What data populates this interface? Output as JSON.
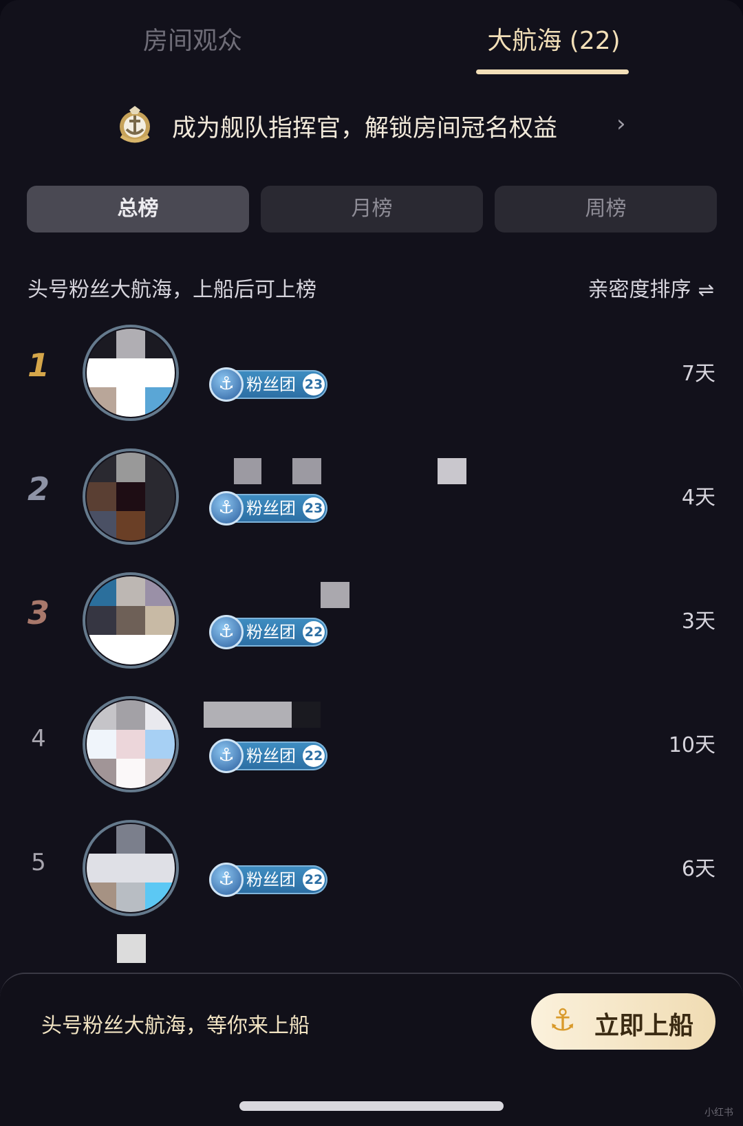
{
  "tabs": {
    "audience": "房间观众",
    "fleet": "大航海 (22)"
  },
  "promo": {
    "text": "成为舰队指挥官，解锁房间冠名权益",
    "chevron": "›"
  },
  "segments": [
    "总榜",
    "月榜",
    "周榜"
  ],
  "info": {
    "left": "头号粉丝大航海，上船后可上榜",
    "sort": "亲密度排序",
    "sort_icon": "⇌"
  },
  "rows": [
    {
      "rank": "1",
      "badge_label": "粉丝团",
      "badge_level": "23",
      "days": "7天"
    },
    {
      "rank": "2",
      "badge_label": "粉丝团",
      "badge_level": "23",
      "days": "4天"
    },
    {
      "rank": "3",
      "badge_label": "粉丝团",
      "badge_level": "22",
      "days": "3天"
    },
    {
      "rank": "4",
      "badge_label": "粉丝团",
      "badge_level": "22",
      "days": "10天"
    },
    {
      "rank": "5",
      "badge_label": "粉丝团",
      "badge_level": "22",
      "days": "6天"
    }
  ],
  "bottom": {
    "text": "头号粉丝大航海，等你来上船",
    "button": "立即上船",
    "button_icon": "⚓"
  },
  "watermark": "小红书",
  "colors": {
    "accent": "#f2dfb8",
    "badge": "#2c6ea3",
    "rank1": "#d5a64a"
  }
}
